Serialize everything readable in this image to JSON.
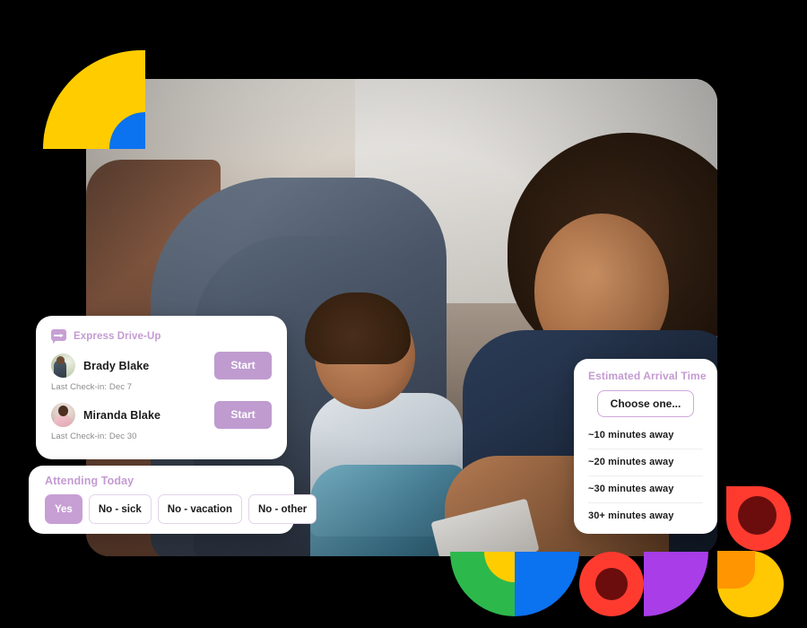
{
  "express_card": {
    "icon": "speech-bubble-arrow-icon",
    "title": "Express Drive-Up",
    "people": [
      {
        "name": "Brady Blake",
        "last_checkin": "Last Check-in: Dec 7",
        "action_label": "Start",
        "avatar": "avatar-brady"
      },
      {
        "name": "Miranda Blake",
        "last_checkin": "Last Check-in: Dec 30",
        "action_label": "Start",
        "avatar": "avatar-miranda"
      }
    ]
  },
  "attending_card": {
    "title": "Attending Today",
    "options": [
      {
        "label": "Yes",
        "selected": true
      },
      {
        "label": "No - sick",
        "selected": false
      },
      {
        "label": "No - vacation",
        "selected": false
      },
      {
        "label": "No - other",
        "selected": false
      }
    ]
  },
  "arrival_card": {
    "title": "Estimated Arrival Time",
    "select_label": "Choose one...",
    "options": [
      "~10 minutes away",
      "~20 minutes away",
      "~30 minutes away",
      "30+ minutes away"
    ]
  },
  "colors": {
    "accent_purple": "#c49bd2",
    "button_purple": "#bf9bd0",
    "selected_purple": "#c79fd4",
    "outline_purple": "#cfa8dc",
    "decor_yellow": "#FFCC00",
    "decor_blue": "#0B72F0",
    "decor_green": "#2DB84C",
    "decor_red": "#FF3B30",
    "decor_maroon": "#6B0D0D",
    "decor_purple": "#A93EE8",
    "decor_orange": "#FF9500",
    "background": "#000000",
    "card_white": "#ffffff",
    "text_dark": "#1b1b1b",
    "text_muted": "#8b8b8b"
  }
}
